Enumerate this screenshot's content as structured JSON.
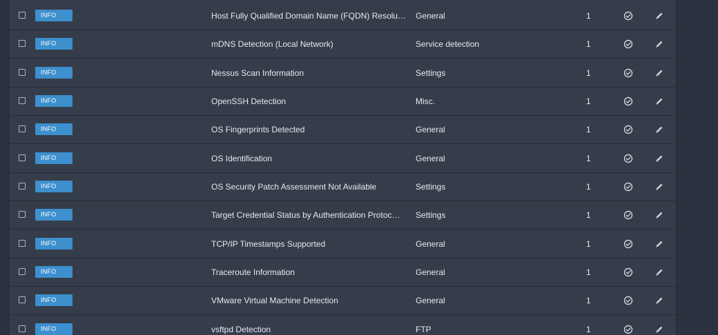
{
  "colors": {
    "background": "#2b3340",
    "row": "#353d4b",
    "badge": "#3d8fce",
    "text": "#e6eaf0"
  },
  "rows": [
    {
      "severity": "INFO",
      "name": "Host Fully Qualified Domain Name (FQDN) Resolu…",
      "family": "General",
      "count": "1",
      "status_icon": "check-circle-icon",
      "action_icon": "pencil-icon"
    },
    {
      "severity": "INFO",
      "name": "mDNS Detection (Local Network)",
      "family": "Service detection",
      "count": "1",
      "status_icon": "check-circle-icon",
      "action_icon": "pencil-icon"
    },
    {
      "severity": "INFO",
      "name": "Nessus Scan Information",
      "family": "Settings",
      "count": "1",
      "status_icon": "check-circle-icon",
      "action_icon": "pencil-icon"
    },
    {
      "severity": "INFO",
      "name": "OpenSSH Detection",
      "family": "Misc.",
      "count": "1",
      "status_icon": "check-circle-icon",
      "action_icon": "pencil-icon"
    },
    {
      "severity": "INFO",
      "name": "OS Fingerprints Detected",
      "family": "General",
      "count": "1",
      "status_icon": "check-circle-icon",
      "action_icon": "pencil-icon"
    },
    {
      "severity": "INFO",
      "name": "OS Identification",
      "family": "General",
      "count": "1",
      "status_icon": "check-circle-icon",
      "action_icon": "pencil-icon"
    },
    {
      "severity": "INFO",
      "name": "OS Security Patch Assessment Not Available",
      "family": "Settings",
      "count": "1",
      "status_icon": "check-circle-icon",
      "action_icon": "pencil-icon"
    },
    {
      "severity": "INFO",
      "name": "Target Credential Status by Authentication Protoc…",
      "family": "Settings",
      "count": "1",
      "status_icon": "check-circle-icon",
      "action_icon": "pencil-icon"
    },
    {
      "severity": "INFO",
      "name": "TCP/IP Timestamps Supported",
      "family": "General",
      "count": "1",
      "status_icon": "check-circle-icon",
      "action_icon": "pencil-icon"
    },
    {
      "severity": "INFO",
      "name": "Traceroute Information",
      "family": "General",
      "count": "1",
      "status_icon": "check-circle-icon",
      "action_icon": "pencil-icon"
    },
    {
      "severity": "INFO",
      "name": "VMware Virtual Machine Detection",
      "family": "General",
      "count": "1",
      "status_icon": "check-circle-icon",
      "action_icon": "pencil-icon"
    },
    {
      "severity": "INFO",
      "name": "vsftpd Detection",
      "family": "FTP",
      "count": "1",
      "status_icon": "check-circle-icon",
      "action_icon": "pencil-icon"
    }
  ]
}
